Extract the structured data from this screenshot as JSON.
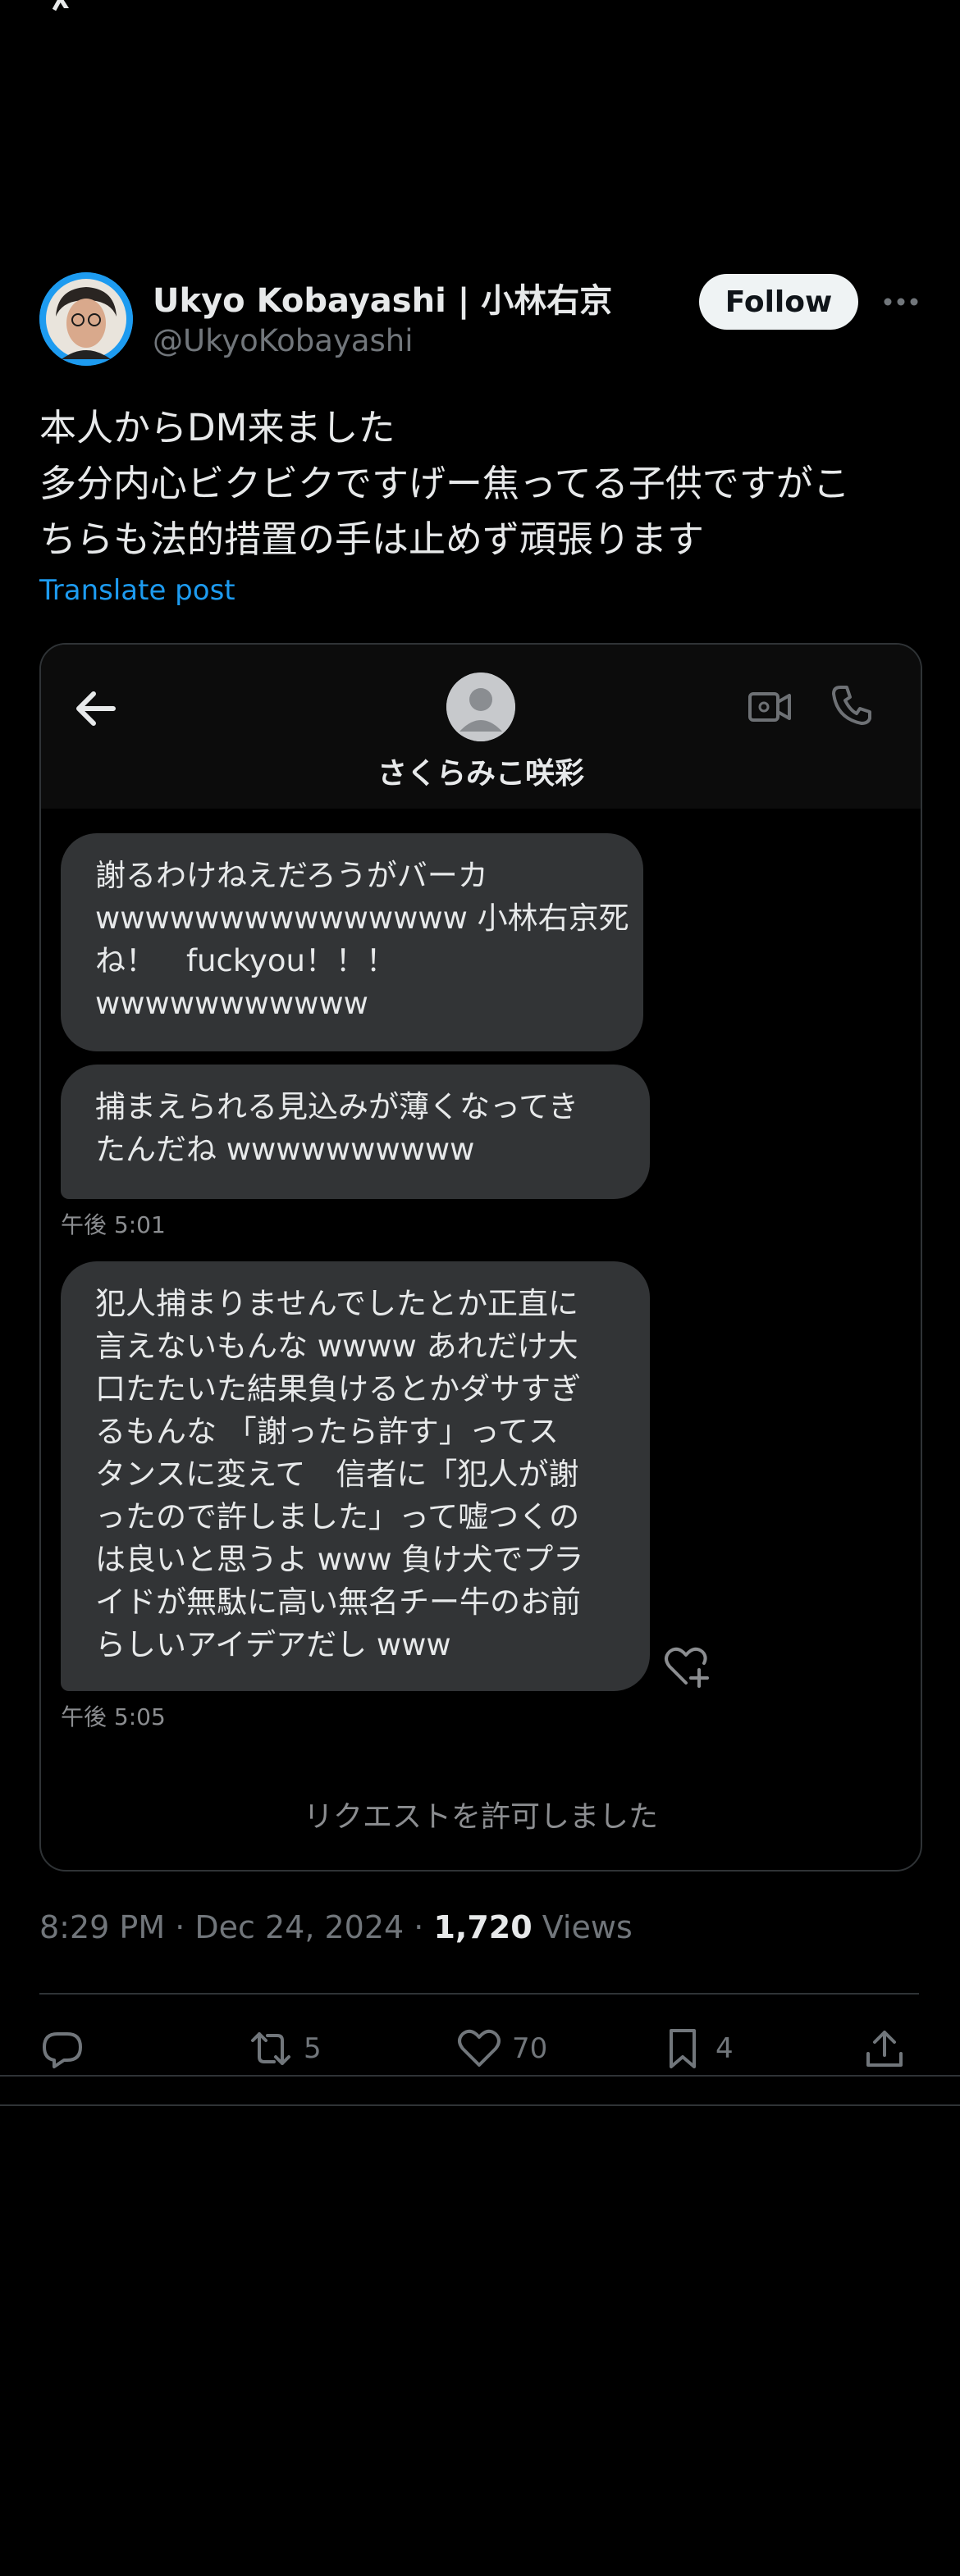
{
  "author": {
    "name": "Ukyo Kobayashi | 小林右京",
    "handle": "@UkyoKobayashi"
  },
  "follow_label": "Follow",
  "tweet": {
    "lines": [
      "本人からDM来ました",
      "多分内心ビクビクですげー焦ってる子供ですがこ",
      "ちらも法的措置の手は止めず頑張ります"
    ],
    "translate_label": "Translate post"
  },
  "dm": {
    "contact_name": "さくらみこ咲彩",
    "messages": [
      {
        "lines": [
          "謝るわけねえだろうがバーカ",
          "wwwwwwwwwwwwwww 小林右京死",
          "ね！　fuckyou！！！",
          "wwwwwwwwwww"
        ]
      },
      {
        "lines": [
          "捕まえられる見込みが薄くなってき",
          "たんだね wwwwwwwwww"
        ]
      },
      {
        "lines": [
          "犯人捕まりませんでしたとか正直に",
          "言えないもんな wwww あれだけ大",
          "口たたいた結果負けるとかダサすぎ",
          "るもんな 「謝ったら許す」ってス",
          "タンスに変えて　信者に「犯人が謝",
          "ったので許しました」って嘘つくの",
          "は良いと思うよ www 負け犬でプラ",
          "イドが無駄に高い無名チー牛のお前",
          "らしいアイデアだし www"
        ]
      }
    ],
    "timestamps": [
      "午後 5:01",
      "午後 5:05"
    ],
    "request_status": "リクエストを許可しました"
  },
  "meta": {
    "time": "8:29 PM",
    "date": "Dec 24, 2024",
    "views_count": "1,720",
    "views_label": "Views"
  },
  "actions": {
    "reposts": "5",
    "likes": "70",
    "bookmarks": "4"
  },
  "colors": {
    "background": "#000000",
    "accent": "#1d9bf0",
    "bubble": "#323436",
    "muted": "#71767b"
  },
  "icons": [
    "x-logo-icon",
    "more-icon",
    "back-arrow-icon",
    "video-icon",
    "phone-icon",
    "heart-plus-icon",
    "reply-icon",
    "repost-icon",
    "like-icon",
    "bookmark-icon",
    "share-icon"
  ]
}
